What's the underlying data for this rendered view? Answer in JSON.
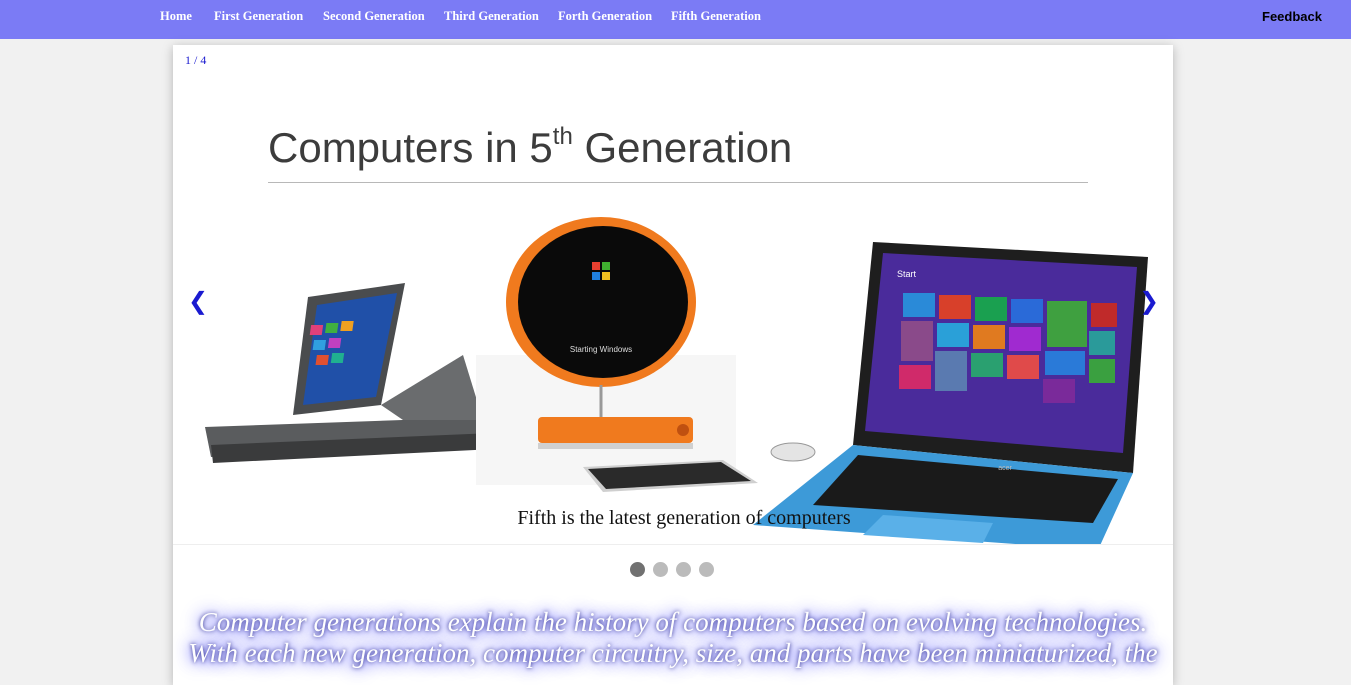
{
  "nav": {
    "links": [
      "Home",
      "First Generation",
      "Second Generation",
      "Third Generation",
      "Forth Generation",
      "Fifth Generation"
    ],
    "feedback": "Feedback"
  },
  "slideshow": {
    "counter": "1 / 4",
    "heading_main": "Computers in 5",
    "heading_sup": "th",
    "heading_end": " Generation",
    "caption": "Fifth is the latest generation of computers",
    "prev_label": "❮",
    "next_label": "❯",
    "dots": 4,
    "active_dot": 0,
    "screen_text_left": "Starting Windows",
    "screen_text_right": "Start",
    "laptop_brand": "acer"
  },
  "intro": {
    "text": "Computer generations explain the history of computers based on evolving technologies. With each new generation, computer circuitry, size, and parts have been miniaturized, the"
  },
  "colors": {
    "nav_bg": "#7b7bf5",
    "accent": "#1a1ad0",
    "laptop_blue": "#3d9ad8",
    "retro_orange": "#f07a1e"
  }
}
